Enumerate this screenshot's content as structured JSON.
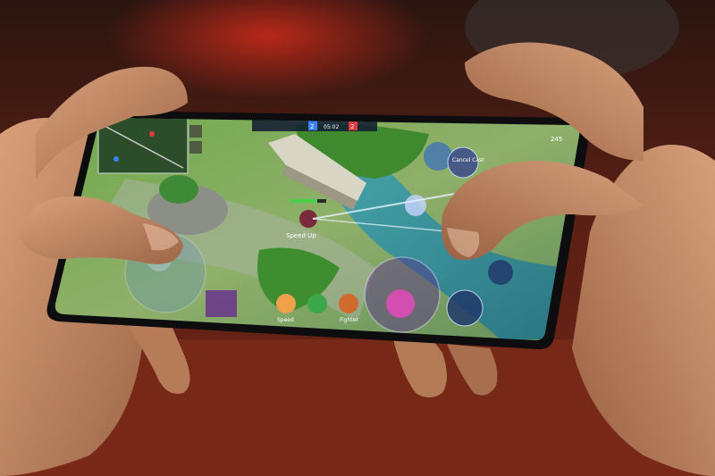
{
  "hud": {
    "team_kills": "2",
    "match_time": "05:02",
    "enemy_kills": "2",
    "gold": "245"
  },
  "labels": {
    "speed_up": "Speed Up",
    "cancel_cast": "Cancel Cast",
    "skill_a": "Speed",
    "skill_b": "Fighter"
  },
  "colors": {
    "table": "#7a2a17",
    "skin": "#c98f68",
    "grass": "#5a9a3a",
    "water": "#2e8fa6",
    "team_blue": "#3b82f6",
    "team_red": "#e23b3b"
  },
  "icons": [
    "minimap",
    "settings-gear-icon",
    "chat-icon",
    "joystick",
    "attack-button",
    "skill-button",
    "shop-icon"
  ]
}
